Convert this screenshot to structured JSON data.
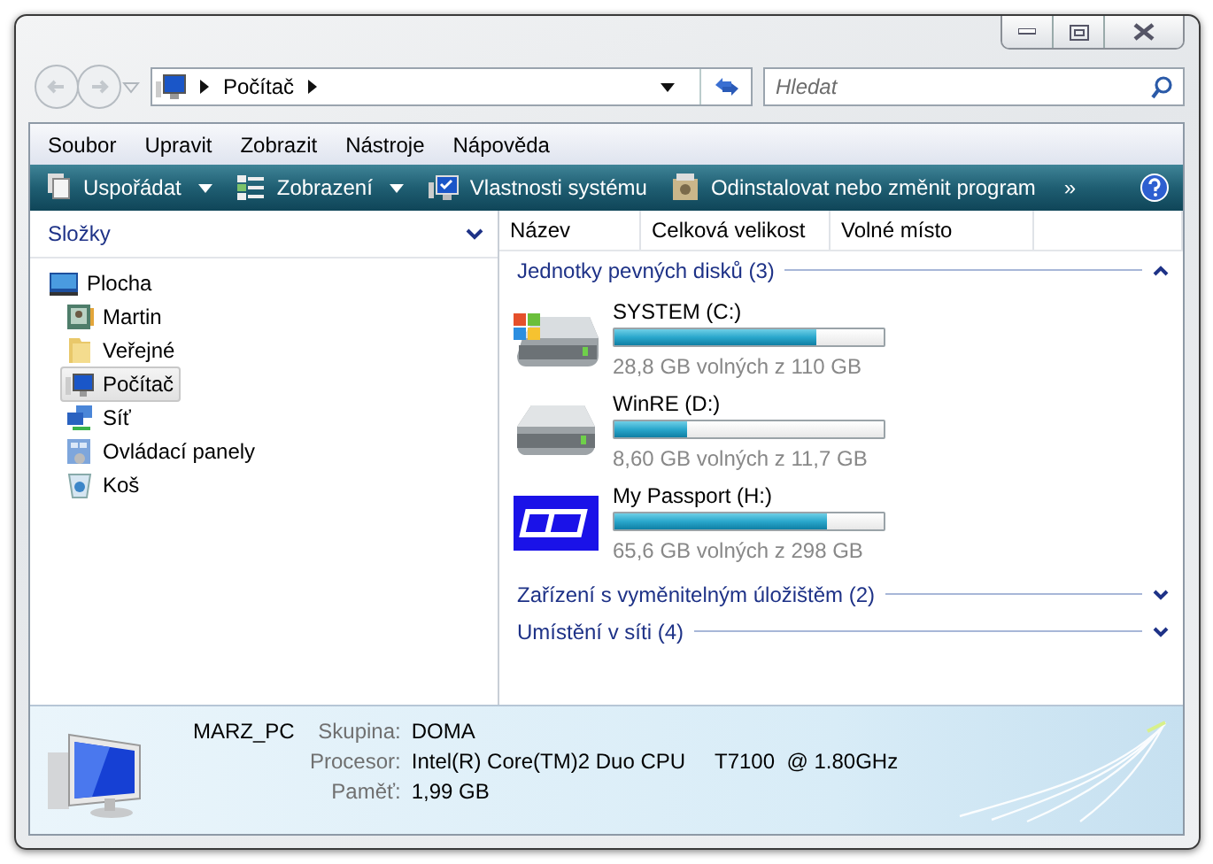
{
  "address": {
    "path": [
      "Počítač"
    ]
  },
  "search": {
    "placeholder": "Hledat"
  },
  "menu": [
    "Soubor",
    "Upravit",
    "Zobrazit",
    "Nástroje",
    "Nápověda"
  ],
  "toolbar": {
    "items": [
      {
        "label": "Uspořádat",
        "kind": "organize"
      },
      {
        "label": "Zobrazení",
        "kind": "views"
      },
      {
        "label": "Vlastnosti systému",
        "kind": "properties"
      },
      {
        "label": "Odinstalovat nebo změnit program",
        "kind": "uninstall"
      }
    ],
    "overflow": "»"
  },
  "folders": {
    "title": "Složky",
    "items": [
      {
        "label": "Plocha",
        "kind": "desktop",
        "selected": false,
        "children": [
          {
            "label": "Martin",
            "kind": "user",
            "selected": false
          },
          {
            "label": "Veřejné",
            "kind": "folder",
            "selected": false
          },
          {
            "label": "Počítač",
            "kind": "computer",
            "selected": true
          },
          {
            "label": "Síť",
            "kind": "network",
            "selected": false
          },
          {
            "label": "Ovládací panely",
            "kind": "control",
            "selected": false
          },
          {
            "label": "Koš",
            "kind": "bin",
            "selected": false
          }
        ]
      }
    ]
  },
  "columns": [
    "Název",
    "Celková velikost",
    "Volné místo"
  ],
  "groups": [
    {
      "title": "Jednotky pevných disků (3)",
      "expanded": true,
      "drives": [
        {
          "name": "SYSTEM (C:)",
          "kind": "system",
          "level": 0.75,
          "free": "28,8 GB volných z 110 GB"
        },
        {
          "name": "WinRE (D:)",
          "kind": "disk",
          "level": 0.27,
          "free": "8,60 GB volných z 11,7 GB"
        },
        {
          "name": "My Passport (H:)",
          "kind": "wd",
          "level": 0.79,
          "free": "65,6 GB volných z 298 GB"
        }
      ]
    },
    {
      "title": "Zařízení s vyměnitelným úložištěm (2)",
      "expanded": false
    },
    {
      "title": "Umístění v síti (4)",
      "expanded": false
    }
  ],
  "details": {
    "computer": "MARZ_PC",
    "fields": [
      {
        "label": "Skupina:",
        "value": "DOMA"
      },
      {
        "label": "Procesor:",
        "value": "Intel(R) Core(TM)2 Duo CPU     T7100  @ 1.80GHz"
      },
      {
        "label": "Paměť:",
        "value": "1,99 GB"
      }
    ]
  }
}
